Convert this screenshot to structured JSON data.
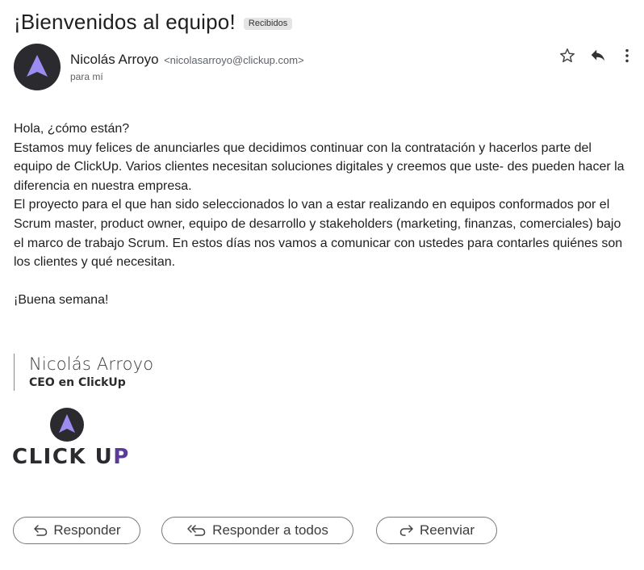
{
  "email": {
    "subject": "¡Bienvenidos al equipo!",
    "label": "Recibidos",
    "sender_name": "Nicolás Arroyo",
    "sender_email": "<nicolasarroyo@clickup.com>",
    "recipient": "para mí"
  },
  "icons": {
    "star": "star-icon",
    "reply": "reply-icon",
    "more": "more-vertical-icon",
    "reply_button": "reply-arrow-icon",
    "reply_all_button": "reply-all-icon",
    "forward_button": "forward-icon"
  },
  "body": {
    "greeting": "Hola, ¿cómo están?",
    "paragraph1": "Estamos muy felices de anunciarles que decidimos continuar con la contratación y hacerlos parte del equipo de ClickUp. Varios clientes necesitan soluciones digitales y creemos que uste- des pueden hacer la diferencia en nuestra empresa.",
    "paragraph2": "El proyecto para el que han sido seleccionados lo van a estar realizando en equipos conformados por el Scrum master, product owner, equipo de desarrollo y stakeholders (marketing, finanzas, comerciales) bajo el marco de trabajo Scrum. En estos días nos vamos a comunicar con ustedes para contarles quiénes son los clientes y qué necesitan.",
    "closing": "¡Buena semana!"
  },
  "signature": {
    "name": "Nicolás Arroyo",
    "role": "CEO en ClickUp",
    "logo_text_main": "CLICK U",
    "logo_text_accent": "P"
  },
  "actions": {
    "reply": "Responder",
    "reply_all": "Responder a todos",
    "forward": "Reenviar"
  },
  "colors": {
    "accent_purple": "#9b8cf2",
    "logo_dark": "#2b2b2f",
    "logo_accent": "#5b3a9b"
  }
}
